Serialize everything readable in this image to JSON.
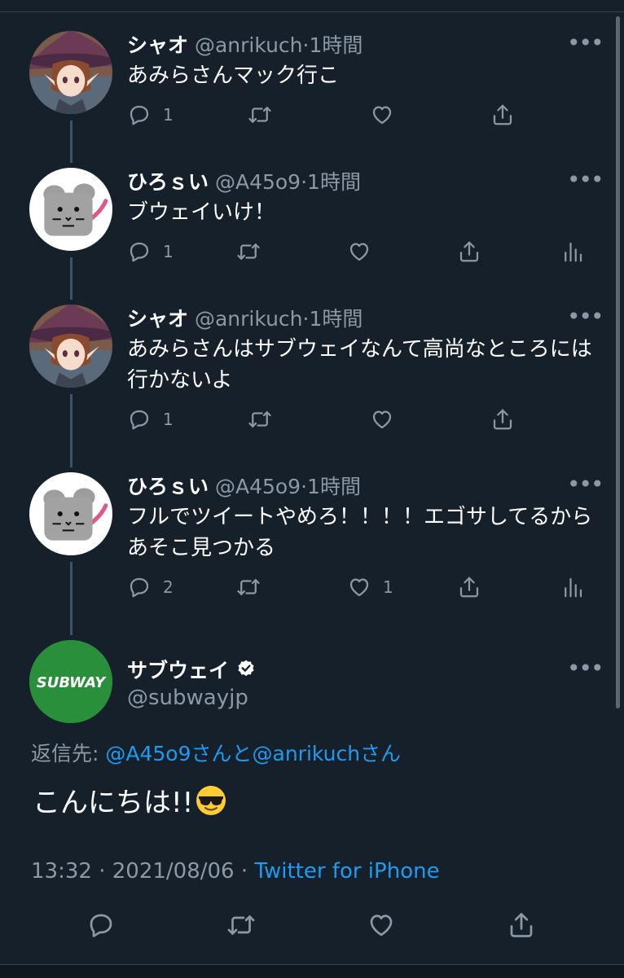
{
  "tweets": [
    {
      "name": "シャオ",
      "handle": "@anrikuch",
      "dot": "·",
      "time": "1時間",
      "text": "あみらさんマック行こ",
      "reply_count": "1",
      "like_count": ""
    },
    {
      "name": "ひろｓい",
      "handle": "@A45o9",
      "dot": "·",
      "time": "1時間",
      "text": "ブウェイいけ！",
      "reply_count": "1",
      "like_count": ""
    },
    {
      "name": "シャオ",
      "handle": "@anrikuch",
      "dot": "·",
      "time": "1時間",
      "text": "あみらさんはサブウェイなんて高尚なところには行かないよ",
      "reply_count": "1",
      "like_count": ""
    },
    {
      "name": "ひろｓい",
      "handle": "@A45o9",
      "dot": "·",
      "time": "1時間",
      "text": "フルでツイートやめろ！！！！エゴサしてるからあそこ見つかる",
      "reply_count": "2",
      "like_count": "1"
    }
  ],
  "main_tweet": {
    "name": "サブウェイ",
    "handle": "@subwayjp",
    "logo_text": "SUBWAY",
    "reply_prefix": "返信先: ",
    "reply_user1": "@A45o9さん",
    "reply_and": "と",
    "reply_user2": "@anrikuchさん",
    "text": "こんにちは!!",
    "emoji": "sunglasses-face",
    "time": "13:32",
    "sep": " · ",
    "date": "2021/08/06",
    "source": "Twitter for iPhone"
  },
  "more_label": "•••",
  "colors": {
    "background": "#15202b",
    "text": "#ffffff",
    "secondary": "#8b98a5",
    "link": "#1d9bf0",
    "subway_green": "#2a8f3a",
    "subway_yellow": "#ffc600"
  }
}
